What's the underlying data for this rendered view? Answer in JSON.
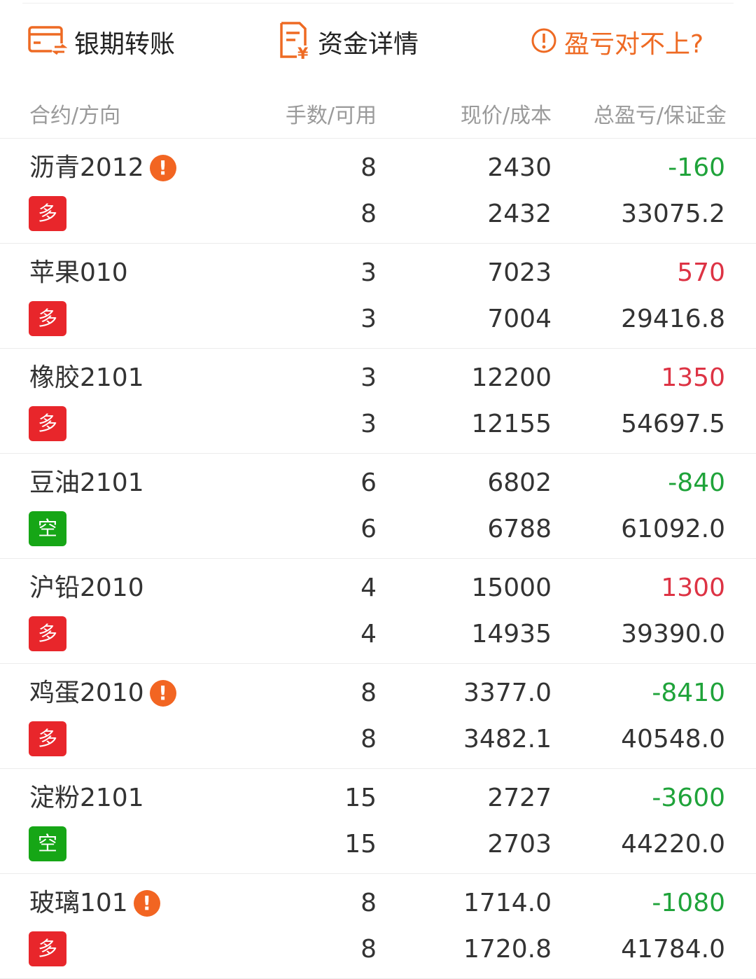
{
  "toolbar": {
    "transfer_label": "银期转账",
    "detail_label": "资金详情",
    "pnl_issue_label": "盈亏对不上?",
    "accent_color": "#ee6a23"
  },
  "header": {
    "col_contract": "合约/方向",
    "col_lots": "手数/可用",
    "col_price": "现价/成本",
    "col_pnl": "总盈亏/保证金"
  },
  "positions": [
    {
      "name": "沥青2012",
      "warning": true,
      "direction": "多",
      "direction_type": "long",
      "lots": "8",
      "available": "8",
      "price": "2430",
      "cost": "2432",
      "pnl": "-160",
      "pnl_sign": "neg",
      "margin": "33075.2"
    },
    {
      "name": "苹果010",
      "warning": false,
      "direction": "多",
      "direction_type": "long",
      "lots": "3",
      "available": "3",
      "price": "7023",
      "cost": "7004",
      "pnl": "570",
      "pnl_sign": "pos",
      "margin": "29416.8"
    },
    {
      "name": "橡胶2101",
      "warning": false,
      "direction": "多",
      "direction_type": "long",
      "lots": "3",
      "available": "3",
      "price": "12200",
      "cost": "12155",
      "pnl": "1350",
      "pnl_sign": "pos",
      "margin": "54697.5"
    },
    {
      "name": "豆油2101",
      "warning": false,
      "direction": "空",
      "direction_type": "short",
      "lots": "6",
      "available": "6",
      "price": "6802",
      "cost": "6788",
      "pnl": "-840",
      "pnl_sign": "neg",
      "margin": "61092.0"
    },
    {
      "name": "沪铅2010",
      "warning": false,
      "direction": "多",
      "direction_type": "long",
      "lots": "4",
      "available": "4",
      "price": "15000",
      "cost": "14935",
      "pnl": "1300",
      "pnl_sign": "pos",
      "margin": "39390.0"
    },
    {
      "name": "鸡蛋2010",
      "warning": true,
      "direction": "多",
      "direction_type": "long",
      "lots": "8",
      "available": "8",
      "price": "3377.0",
      "cost": "3482.1",
      "pnl": "-8410",
      "pnl_sign": "neg",
      "margin": "40548.0"
    },
    {
      "name": "淀粉2101",
      "warning": false,
      "direction": "空",
      "direction_type": "short",
      "lots": "15",
      "available": "15",
      "price": "2727",
      "cost": "2703",
      "pnl": "-3600",
      "pnl_sign": "neg",
      "margin": "44220.0"
    },
    {
      "name": "玻璃101",
      "warning": true,
      "direction": "多",
      "direction_type": "long",
      "lots": "8",
      "available": "8",
      "price": "1714.0",
      "cost": "1720.8",
      "pnl": "-1080",
      "pnl_sign": "neg",
      "margin": "41784.0"
    }
  ],
  "colors": {
    "long": "#e8262b",
    "short": "#16a616",
    "profit": "#dd3344",
    "loss": "#1fa33a"
  }
}
